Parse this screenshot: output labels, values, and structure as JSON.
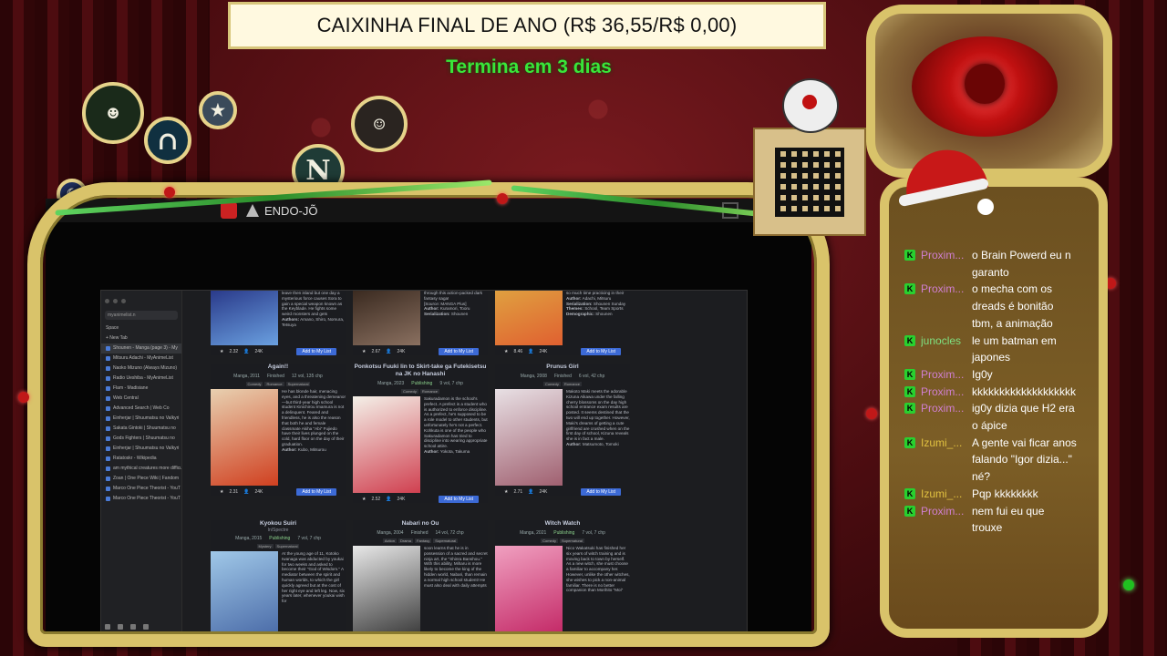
{
  "banner": {
    "title": "CAIXINHA FINAL DE ANO (R$ 36,55/R$ 0,00)",
    "subtitle": "Termina em 3 dias"
  },
  "medallions": [
    "N"
  ],
  "game_window": {
    "title": "ENDO-JÕ"
  },
  "browser": {
    "url": "myanimelist.n",
    "space": "Space",
    "new_tab": "+ New Tab",
    "tabs": [
      {
        "label": "Shounen - Manga (page 3) - My",
        "active": true
      },
      {
        "label": "Mitsuru Adachi - MyAnimeList"
      },
      {
        "label": "Naoko Mizuno (Always Mizuno)"
      },
      {
        "label": "Radio Ueshiba - MyAnimeList"
      },
      {
        "label": "Flam - Madisiane"
      },
      {
        "label": "Web Central"
      },
      {
        "label": "Advanced Search | Web Co"
      },
      {
        "label": "Einherjar | Shuumatsu no Valkyri"
      },
      {
        "label": "Sakata Gintoki | Shuumatsu no"
      },
      {
        "label": "Gods Fighters | Shuumatsu no"
      },
      {
        "label": "Einherjar | Shuumatsu no Valkyri"
      },
      {
        "label": "Ratatoskr - Wikipedia"
      },
      {
        "label": "am mythical creatures more difficult"
      },
      {
        "label": "Zoan | One Piece Wiki | Fandom"
      },
      {
        "label": "Marco One Piece Theorist - YouT"
      },
      {
        "label": "Marco One Piece Theorist - YouT"
      }
    ],
    "top_cards": [
      {
        "synopsis": "leave then island but one day a mysterious force causes Sora to gain a special weapon known as the Keyblade. He fights some weird monsters and gets",
        "author_label": "Authors:",
        "author": "Amano, Shiro, Nomura, Tetsuya",
        "score": "2.32",
        "members": "24K",
        "button": "Add to My List"
      },
      {
        "synopsis": "through this action-packed dark fantasy saga!",
        "source": "[Source: MANGA Plus]",
        "author_label": "Author:",
        "author": "Kuramori, Tooru",
        "serialization_label": "Serialization:",
        "serialization": "Shounen",
        "score": "2.67",
        "members": "24K",
        "button": "Add to My List"
      },
      {
        "synopsis": "so much time practicing in their",
        "author_label": "Author:",
        "author": "Adachi, Mitsuru",
        "serialization_label": "Serialization:",
        "serialization": "Shounen Sunday",
        "themes_label": "Themes:",
        "themes": "School, Team Sports",
        "demographic_label": "Demographic:",
        "demographic": "Shounen",
        "score": "8.46",
        "members": "24K",
        "button": "Add to My List"
      }
    ],
    "cards": [
      {
        "title": "Again!!",
        "type": "Manga, 2011",
        "status": "Finished",
        "volumes": "12 vol, 135 chp",
        "tags": [
          "Comedy",
          "Romance",
          "Supernatural"
        ],
        "synopsis": "He has blonde hair, menacing eyes, and a threatening demeanor—but third-year high school student Kinichirou Imamura is not a delinquent. Feared and friendless, he is also the reason that both he and female classmate Akiha \"Abi\" Fujiedo have their lives plunged on the cold, hard floor on the day of their graduation.",
        "author_label": "Author:",
        "author": "Kubo, Mitsurou",
        "score": "2.31",
        "members": "24K",
        "button": "Add to My List"
      },
      {
        "title": "Ponkotsu Fuuki Iin to Skirt-take ga Futekisetsu na JK no Hanashi",
        "type": "Manga, 2023",
        "status": "Publishing",
        "volumes": "9 vol, 7 chp",
        "tags": [
          "Comedy",
          "Romance"
        ],
        "synopsis": "Sakuradamon is the school's prefect. A prefect is a student who is authorized to enforce discipline. As a prefect, he's supposed to be a role model to other students, but unfortunately he's not a perfect. Kohkuta is one of the people who Sakuradamon has tried to discipline into wearing appropriate school attire.",
        "author_label": "Author:",
        "author": "Yokota, Takuma",
        "score": "2.52",
        "members": "24K",
        "button": "Add to My List"
      },
      {
        "title": "Prunus Girl",
        "type": "Manga, 2008",
        "status": "Finished",
        "volumes": "6 vol, 42 chp",
        "tags": [
          "Comedy",
          "Romance"
        ],
        "synopsis": "Makoto Maki meets the adorable Kizuna Aikawa under the falling cherry blossoms on the day high school entrance exam results are posted. It seems destined that the two will end up together. However, Maki's dreams of getting a cute girlfriend are crushed when on the first day of school, Kizuna reveals she is in fact a male.",
        "author_label": "Author:",
        "author": "Matsumoto, Tomoki",
        "score": "2.71",
        "members": "24K",
        "button": "Add to My List"
      },
      {
        "title": "Kyokou Suiri",
        "subtitle": "In/Spectre",
        "type": "Manga, 2015",
        "status": "Publishing",
        "volumes": "7 vol, 7 chp",
        "tags": [
          "Mystery",
          "Supernatural"
        ],
        "synopsis": "At the young age of 11, Kotoko Iwanaga was abducted by youkai for two weeks and asked to become their \"God of Wisdom.\" A mediator between the spirit and human worlds, to which the girl quickly agreed but at the cost of her right eye and left leg. Now, six years later, whenever youkai wish for",
        "score": "",
        "members": "",
        "button": ""
      },
      {
        "title": "Nabari no Ou",
        "type": "Manga, 2004",
        "status": "Finished",
        "volumes": "14 vol, 72 chp",
        "tags": [
          "Action",
          "Drama",
          "Fantasy",
          "Supernatural"
        ],
        "synopsis": "soon learns that he is in possession of a sacred and secret ninja art, the \"Shinra Banshou.\" With this ability, Miharu is more likely to become the king of the hidden world, Nabari, than remain a normal high school student! He must also deal with daily attempts",
        "score": "",
        "members": "",
        "button": ""
      },
      {
        "title": "Witch Watch",
        "type": "Manga, 2021",
        "status": "Publishing",
        "volumes": "7 vol, 7 chp",
        "tags": [
          "Comedy",
          "Supernatural"
        ],
        "synopsis": "Nico Wakatsuki has finished her six years of witch training and is moving back to town by herself. As a new witch, she must choose a familiar to accompany her. However, unlike the other witches, she wishes to pick a non-animal familiar. There is no better companion than Morihito \"Moi\"",
        "score": "",
        "members": "",
        "button": ""
      }
    ]
  },
  "chat": {
    "messages": [
      {
        "user": "Proxim...",
        "user_color": "#d07fd0",
        "text": "o Brain Powerd eu n garanto"
      },
      {
        "user": "Proxim...",
        "user_color": "#d07fd0",
        "text": "o mecha com os dreads é bonitão tbm, a animação"
      },
      {
        "user": "junocles",
        "user_color": "#7fe080",
        "text": "le um batman em japones"
      },
      {
        "user": "Proxim...",
        "user_color": "#d07fd0",
        "text": "Ig0y"
      },
      {
        "user": "Proxim...",
        "user_color": "#d07fd0",
        "text": "kkkkkkkkkkkkkkkkkkk"
      },
      {
        "user": "Proxim...",
        "user_color": "#d07fd0",
        "text": "ig0y dizia que H2 era o ápice"
      },
      {
        "user": "Izumi_...",
        "user_color": "#e0c040",
        "text": "A gente vai ficar anos falando \"Igor dizia...\" né?"
      },
      {
        "user": "Izumi_...",
        "user_color": "#e0c040",
        "text": "Pqp kkkkkkkk"
      },
      {
        "user": "Proxim...",
        "user_color": "#d07fd0",
        "text": "nem fui eu que trouxe"
      }
    ]
  }
}
